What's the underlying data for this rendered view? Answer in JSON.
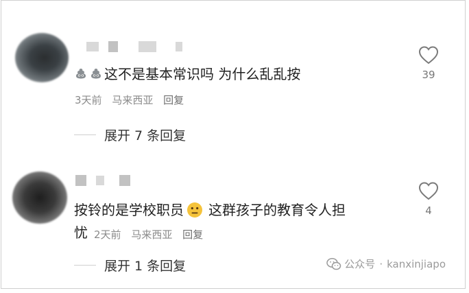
{
  "comments": [
    {
      "text": "这不是基本常识吗 为什么乱乱按",
      "time": "3天前",
      "location": "马来西亚",
      "reply_label": "回复",
      "likes": "39",
      "expand_label": "展开 7 条回复",
      "emoji_prefix": [
        "poop-emoji",
        "poop-emoji"
      ]
    },
    {
      "text_part1": "按铃的是学校职员",
      "text_part2": " 这群孩子的教育令人担",
      "text_line2": "忧",
      "time": "2天前",
      "location": "马来西亚",
      "reply_label": "回复",
      "likes": "4",
      "expand_label": "展开 1 条回复",
      "emoji_inline": "neutral-face-emoji"
    }
  ],
  "watermark": {
    "source": "公众号",
    "separator": "·",
    "account": "kanxinjiapo"
  }
}
